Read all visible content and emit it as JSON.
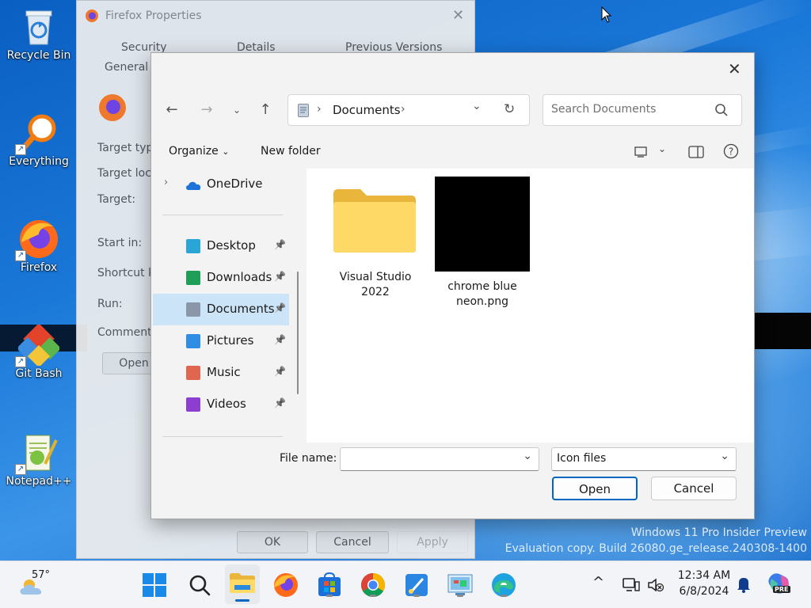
{
  "desktop": {
    "icons": [
      {
        "label": "Recycle Bin",
        "icon": "recycle-bin-icon"
      },
      {
        "label": "Everything",
        "icon": "everything-search-icon"
      },
      {
        "label": "Firefox",
        "icon": "firefox-icon"
      },
      {
        "label": "Git Bash",
        "icon": "git-bash-icon"
      },
      {
        "label": "Notepad++",
        "icon": "notepad-plus-plus-icon"
      }
    ],
    "watermark": {
      "line1": "Windows 11 Pro Insider Preview",
      "line2": "Evaluation copy. Build 26080.ge_release.240308-1400"
    }
  },
  "properties_window": {
    "title": "Firefox Properties",
    "tabs_row1": [
      "Security",
      "Details",
      "Previous Versions"
    ],
    "tabs_row2": [
      "General"
    ],
    "labels": [
      "Target typ",
      "Target loc",
      "Target:",
      "Start in:",
      "Shortcut k",
      "Run:",
      "Comment:"
    ],
    "open_button": "Open",
    "buttons": {
      "ok": "OK",
      "cancel": "Cancel",
      "apply": "Apply"
    }
  },
  "dialog": {
    "breadcrumb": {
      "location": "Documents"
    },
    "search_placeholder": "Search Documents",
    "toolbar": {
      "organize": "Organize",
      "new_folder": "New folder"
    },
    "nav": {
      "onedrive": "OneDrive",
      "items": [
        {
          "label": "Desktop",
          "icon": "desktop-icon",
          "color": "#2aa6d6"
        },
        {
          "label": "Downloads",
          "icon": "downloads-icon",
          "color": "#1e9e57"
        },
        {
          "label": "Documents",
          "icon": "documents-icon",
          "color": "#8a97a8",
          "selected": true
        },
        {
          "label": "Pictures",
          "icon": "pictures-icon",
          "color": "#2f8de4"
        },
        {
          "label": "Music",
          "icon": "music-icon",
          "color": "#e0664f"
        },
        {
          "label": "Videos",
          "icon": "videos-icon",
          "color": "#8b3ecf"
        }
      ]
    },
    "files": [
      {
        "name_line1": "Visual Studio",
        "name_line2": "2022",
        "type": "folder"
      },
      {
        "name_line1": "chrome blue",
        "name_line2": "neon.png",
        "type": "image"
      }
    ],
    "file_name_label": "File name:",
    "file_name_value": "",
    "file_type_value": "Icon files",
    "open_button": "Open",
    "cancel_button": "Cancel"
  },
  "taskbar": {
    "weather": {
      "temp": "57°"
    },
    "clock": {
      "time": "12:34 AM",
      "date": "6/8/2024"
    },
    "apps": [
      "start-icon",
      "search-icon",
      "file-explorer-icon",
      "firefox-icon",
      "microsoft-store-icon",
      "chrome-icon",
      "paint-icon",
      "control-panel-icon",
      "edge-icon"
    ],
    "copilot_badge": "PRE"
  },
  "colors": {
    "accent": "#0067c0",
    "selected_nav": "#cce4f7"
  }
}
